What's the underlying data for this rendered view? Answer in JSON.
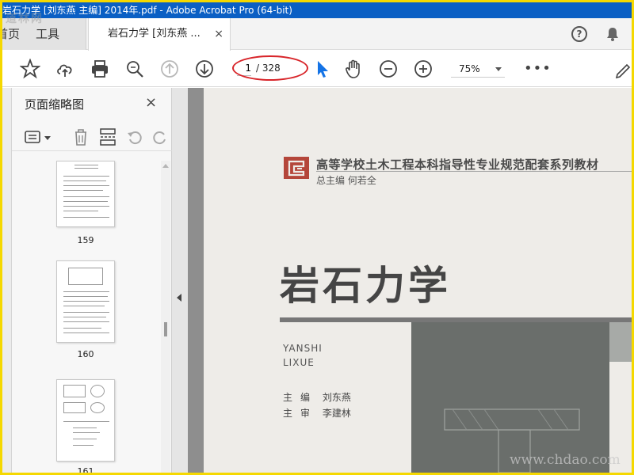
{
  "window": {
    "title": "岩石力学 [刘东燕 主编] 2014年.pdf - Adobe Acrobat Pro (64-bit)"
  },
  "tabs": {
    "home_label": "首页",
    "tools_label": "工具",
    "document_label": "岩石力学 [刘东燕 ...",
    "close_glyph": "×"
  },
  "header_icons": {
    "help": "question-icon",
    "notifications": "bell-icon"
  },
  "toolbar": {
    "current_page": "1",
    "total_pages": "/ 328",
    "zoom": "75%",
    "more": "•••",
    "icons": [
      "star-icon",
      "cloud-upload-icon",
      "print-icon",
      "zoom-search-icon",
      "page-up-icon",
      "page-down-icon",
      "select-cursor-icon",
      "hand-tool-icon",
      "zoom-out-icon",
      "zoom-in-icon",
      "more-icon",
      "pen-icon"
    ]
  },
  "side_panel": {
    "title": "页面缩略图",
    "close_glyph": "×",
    "tools": [
      "thumbnail-options-icon",
      "trash-icon",
      "insert-page-icon",
      "undo-icon",
      "redo-icon"
    ],
    "thumbnails": [
      {
        "page_label": "159"
      },
      {
        "page_label": "160"
      },
      {
        "page_label": "161"
      }
    ]
  },
  "document": {
    "series_title": "高等学校土木工程本科指导性专业规范配套系列教材",
    "series_editor": "总主编   何若全",
    "book_title": "岩石力学",
    "pinyin_line1": "YANSHI",
    "pinyin_line2": "LIXUE",
    "authors": [
      {
        "role": "主编",
        "name": "刘东燕"
      },
      {
        "role": "主审",
        "name": "李建林"
      }
    ]
  },
  "watermarks": {
    "top_left": "道林网",
    "bottom_right": "www.chdao.com"
  },
  "colors": {
    "title_bar": "#0a5fc4",
    "highlight_ellipse": "#d8252a",
    "screenshot_border": "#f5d800",
    "select_cursor": "#1473e6"
  }
}
